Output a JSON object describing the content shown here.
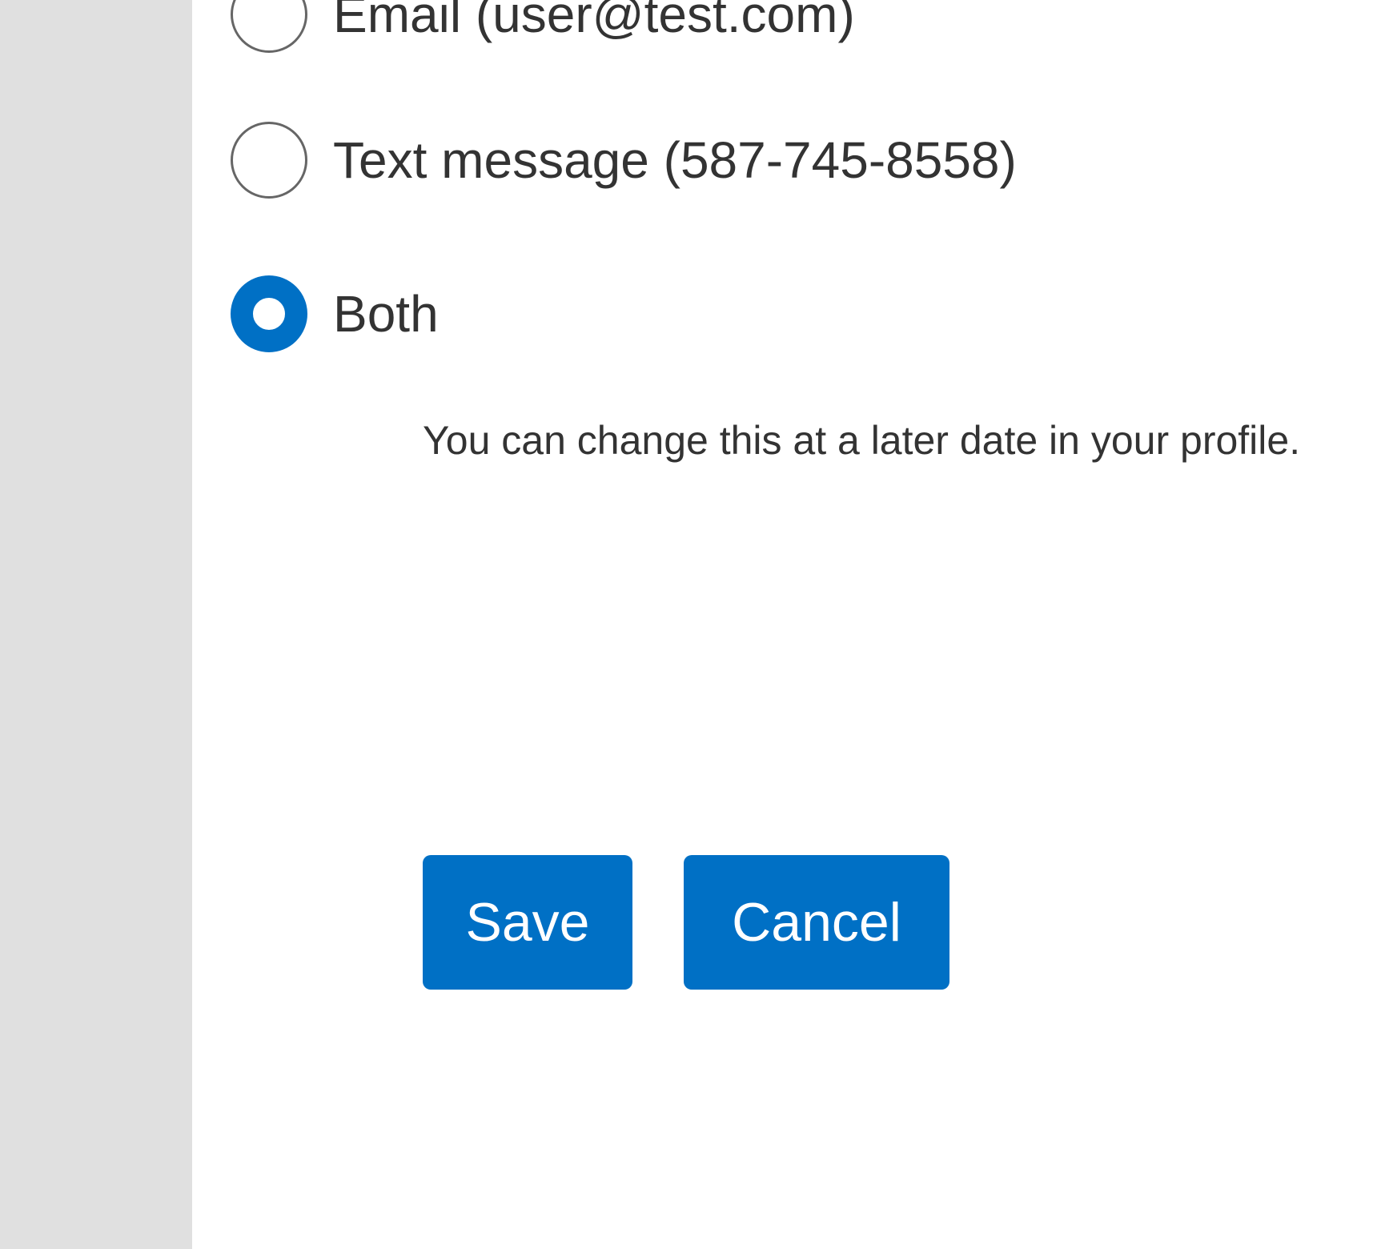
{
  "contact_preference": {
    "options": [
      {
        "label": "Email (user@test.com)",
        "checked": false
      },
      {
        "label": "Text message (587-745-8558)",
        "checked": false
      },
      {
        "label": "Both",
        "checked": true
      }
    ],
    "hint": "You can change this at a later date in your profile."
  },
  "actions": {
    "save_label": "Save",
    "cancel_label": "Cancel"
  },
  "colors": {
    "accent": "#0070c5",
    "rail": "#e0e0e0",
    "text": "#333333"
  }
}
